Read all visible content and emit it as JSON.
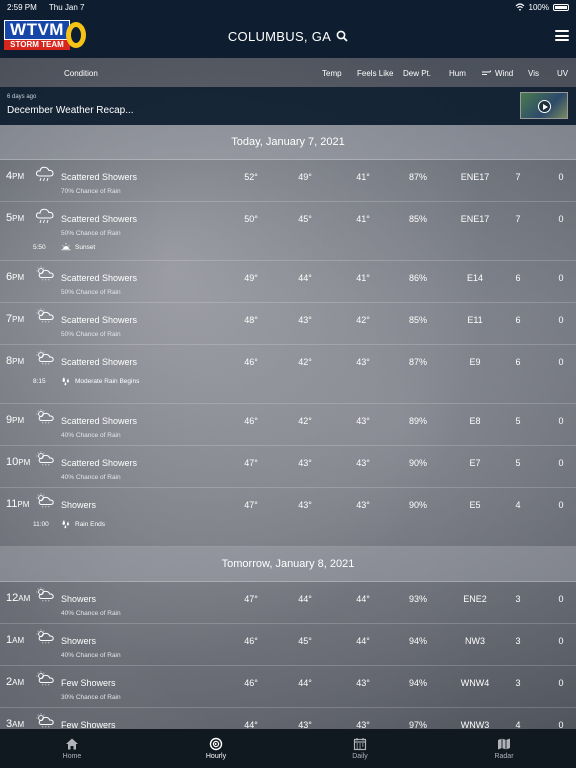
{
  "status": {
    "time": "2:59 PM",
    "date": "Thu Jan 7",
    "battery": "100%"
  },
  "header": {
    "logo_main": "WTVM",
    "logo_sub": "STORM TEAM",
    "city": "COLUMBUS, GA"
  },
  "columns": {
    "condition": "Condition",
    "temp": "Temp",
    "feels_like": "Feels Like",
    "dew_pt": "Dew Pt.",
    "hum": "Hum",
    "wind": "Wind",
    "vis": "Vis",
    "uv": "UV"
  },
  "news": {
    "ago": "6 days ago",
    "title": "December Weather Recap..."
  },
  "days": [
    {
      "label": "Today, January 7, 2021",
      "hours": [
        {
          "hour": "4",
          "ampm": "PM",
          "condition": "Scattered Showers",
          "chance": "70% Chance of Rain",
          "temp": "52°",
          "feels": "49°",
          "dew": "41°",
          "hum": "87%",
          "wind": "ENE17",
          "vis": "7",
          "uv": "0"
        },
        {
          "hour": "5",
          "ampm": "PM",
          "condition": "Scattered Showers",
          "chance": "50% Chance of Rain",
          "temp": "50°",
          "feels": "45°",
          "dew": "41°",
          "hum": "85%",
          "wind": "ENE17",
          "vis": "7",
          "uv": "0",
          "event": {
            "time": "5:50",
            "text": "Sunset",
            "icon": "sunset-icon"
          }
        },
        {
          "hour": "6",
          "ampm": "PM",
          "condition": "Scattered Showers",
          "chance": "50% Chance of Rain",
          "temp": "49°",
          "feels": "44°",
          "dew": "41°",
          "hum": "86%",
          "wind": "E14",
          "vis": "6",
          "uv": "0"
        },
        {
          "hour": "7",
          "ampm": "PM",
          "condition": "Scattered Showers",
          "chance": "50% Chance of Rain",
          "temp": "48°",
          "feels": "43°",
          "dew": "42°",
          "hum": "85%",
          "wind": "E11",
          "vis": "6",
          "uv": "0"
        },
        {
          "hour": "8",
          "ampm": "PM",
          "condition": "Scattered Showers",
          "chance": "",
          "temp": "46°",
          "feels": "42°",
          "dew": "43°",
          "hum": "87%",
          "wind": "E9",
          "vis": "6",
          "uv": "0",
          "event": {
            "time": "8:15",
            "text": "Moderate Rain Begins",
            "icon": "raindrops-icon"
          }
        },
        {
          "hour": "9",
          "ampm": "PM",
          "condition": "Scattered Showers",
          "chance": "40% Chance of Rain",
          "temp": "46°",
          "feels": "42°",
          "dew": "43°",
          "hum": "89%",
          "wind": "E8",
          "vis": "5",
          "uv": "0"
        },
        {
          "hour": "10",
          "ampm": "PM",
          "condition": "Scattered Showers",
          "chance": "40% Chance of Rain",
          "temp": "47°",
          "feels": "43°",
          "dew": "43°",
          "hum": "90%",
          "wind": "E7",
          "vis": "5",
          "uv": "0"
        },
        {
          "hour": "11",
          "ampm": "PM",
          "condition": "Showers",
          "chance": "",
          "temp": "47°",
          "feels": "43°",
          "dew": "43°",
          "hum": "90%",
          "wind": "E5",
          "vis": "4",
          "uv": "0",
          "event": {
            "time": "11:00",
            "text": "Rain Ends",
            "icon": "raindrops-icon"
          }
        }
      ]
    },
    {
      "label": "Tomorrow, January 8, 2021",
      "hours": [
        {
          "hour": "12",
          "ampm": "AM",
          "condition": "Showers",
          "chance": "40% Chance of Rain",
          "temp": "47°",
          "feels": "44°",
          "dew": "44°",
          "hum": "93%",
          "wind": "ENE2",
          "vis": "3",
          "uv": "0"
        },
        {
          "hour": "1",
          "ampm": "AM",
          "condition": "Showers",
          "chance": "40% Chance of Rain",
          "temp": "46°",
          "feels": "45°",
          "dew": "44°",
          "hum": "94%",
          "wind": "NW3",
          "vis": "3",
          "uv": "0"
        },
        {
          "hour": "2",
          "ampm": "AM",
          "condition": "Few Showers",
          "chance": "30% Chance of Rain",
          "temp": "46°",
          "feels": "44°",
          "dew": "43°",
          "hum": "94%",
          "wind": "WNW4",
          "vis": "3",
          "uv": "0"
        },
        {
          "hour": "3",
          "ampm": "AM",
          "condition": "Few Showers",
          "chance": "30% Chance of Rain",
          "temp": "44°",
          "feels": "43°",
          "dew": "43°",
          "hum": "97%",
          "wind": "WNW3",
          "vis": "4",
          "uv": "0"
        }
      ]
    }
  ],
  "tabs": [
    {
      "label": "Home",
      "icon": "home-icon"
    },
    {
      "label": "Hourly",
      "icon": "hourly-icon",
      "active": true
    },
    {
      "label": "Daily",
      "icon": "calendar-icon"
    },
    {
      "label": "Radar",
      "icon": "map-icon"
    }
  ]
}
